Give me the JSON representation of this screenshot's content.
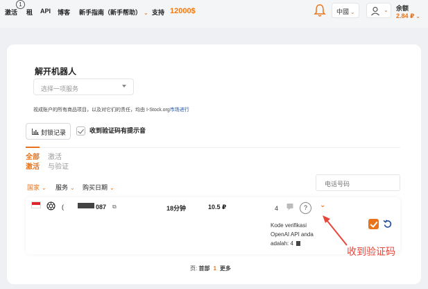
{
  "nav": {
    "badge": "1",
    "links": [
      "激活",
      "租",
      "API",
      "博客",
      "新手指南（新手帮助）",
      "支持"
    ],
    "balance_text": "12000$",
    "language": "中國",
    "balance_label": "余额",
    "balance_value": "2.84 ₽"
  },
  "main": {
    "title": "解开机器人",
    "service_placeholder": "选择一项服务",
    "notice_text": "视成账户的所有商品项目，以及对它们的责任，均由 I-Stock.org",
    "notice_link": "市场进行",
    "lock_button": "封锁记录",
    "sound_checkbox": "收到验证码有提示音",
    "tabs": [
      {
        "line1": "全部",
        "line2": "激活",
        "active": true
      },
      {
        "line1": "激活",
        "line2": "与验证",
        "active": false
      }
    ],
    "filters": [
      "国家",
      "服务",
      "购买日期"
    ],
    "phone_placeholder": "电话号码"
  },
  "row": {
    "number_prefix": "(",
    "number_suffix": "087",
    "duration": "18分钟",
    "price": "10.5 ₽",
    "message_count": "4",
    "help": "?",
    "code_message": [
      "Kode verifikasi",
      "OpenAI API anda",
      "adalah: 4"
    ]
  },
  "annotation": "收到验证码",
  "pager": {
    "label": "页:",
    "first": "首部",
    "current": "1",
    "more": "更多"
  },
  "colors": {
    "accent": "#e8731a",
    "annotation": "#e8463a",
    "link": "#1e4da0"
  }
}
